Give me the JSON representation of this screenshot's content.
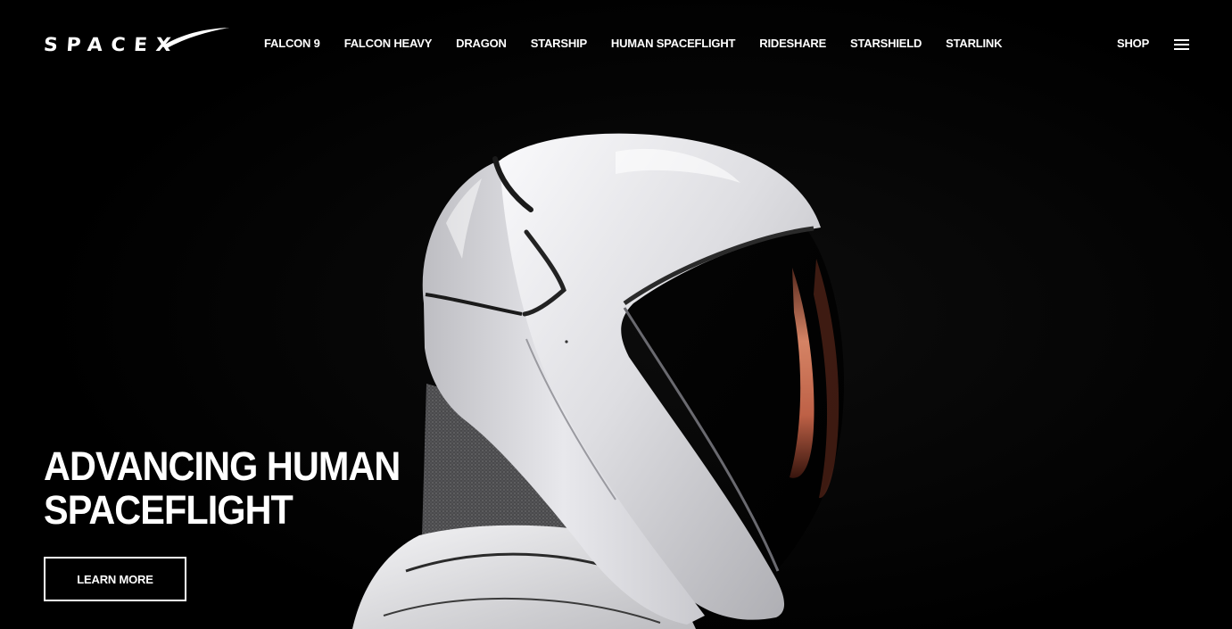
{
  "header": {
    "logo_text": "SPACEX",
    "nav_items": [
      {
        "label": "FALCON 9"
      },
      {
        "label": "FALCON HEAVY"
      },
      {
        "label": "DRAGON"
      },
      {
        "label": "STARSHIP"
      },
      {
        "label": "HUMAN SPACEFLIGHT"
      },
      {
        "label": "RIDESHARE"
      },
      {
        "label": "STARSHIELD"
      },
      {
        "label": "STARLINK"
      }
    ],
    "shop_label": "SHOP",
    "menu_icon": "hamburger-menu-icon"
  },
  "hero": {
    "title_line1": "ADVANCING HUMAN",
    "title_line2": "SPACEFLIGHT",
    "cta_label": "LEARN MORE"
  },
  "colors": {
    "background": "#000000",
    "text": "#ffffff",
    "helmet": "#e6e6ea",
    "visor_reflection": "#d8765a"
  }
}
